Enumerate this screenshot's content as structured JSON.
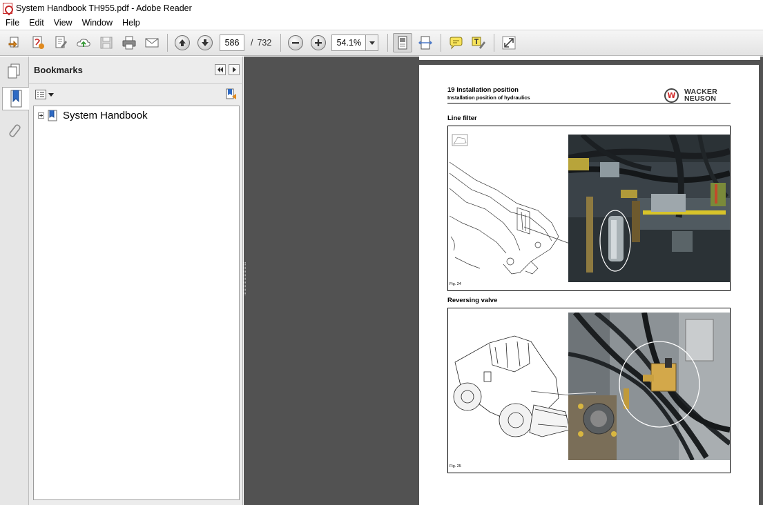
{
  "window": {
    "title": "System Handbook TH955.pdf - Adobe Reader"
  },
  "menu": {
    "items": [
      "File",
      "Edit",
      "View",
      "Window",
      "Help"
    ]
  },
  "toolbar": {
    "current_page": "586",
    "page_separator": "/",
    "total_pages": "732",
    "zoom": "54.1%"
  },
  "bookmarks_panel": {
    "title": "Bookmarks",
    "items": [
      {
        "label": "System Handbook"
      }
    ]
  },
  "document": {
    "header_title": "19 Installation position",
    "header_subtitle": "Installation position of hydraulics",
    "logo_mark": "W",
    "logo_line1": "WACKER",
    "logo_line2": "NEUSON",
    "sections": [
      {
        "title": "Line filter",
        "caption": "Fig. 24"
      },
      {
        "title": "Reversing valve",
        "caption": "Fig. 25"
      }
    ]
  },
  "colors": {
    "doc_background": "#525252",
    "logo_accent": "#d32f2f"
  }
}
